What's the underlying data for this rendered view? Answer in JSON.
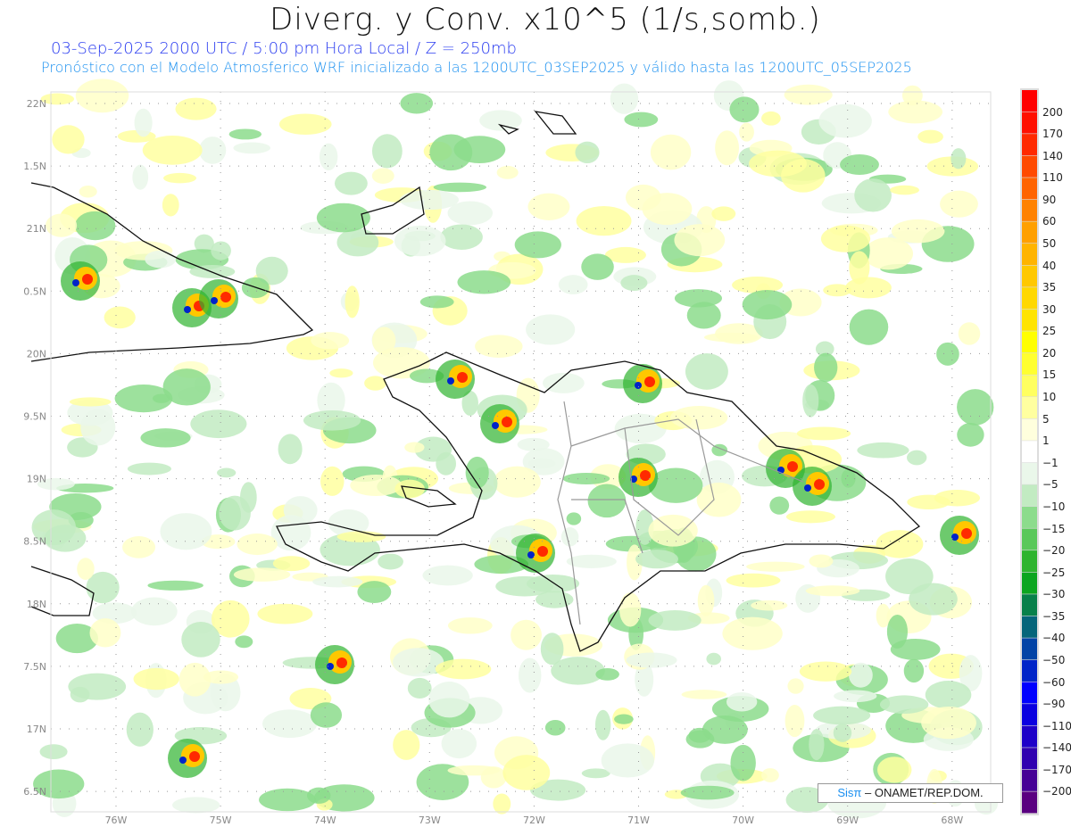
{
  "header": {
    "title": "Diverg. y Conv. x10^5 (1/s,somb.)",
    "subtitle": "03-Sep-2025  2000 UTC / 5:00 pm Hora Local / Z = 250mb",
    "description": "Pronóstico con el Modelo Atmosferico WRF inicializado a las 1200UTC_03SEP2025 y válido hasta las  1200UTC_05SEP2025"
  },
  "axes": {
    "lat_labels": [
      "22N",
      "1.5N",
      "21N",
      "0.5N",
      "20N",
      "9.5N",
      "19N",
      "8.5N",
      "18N",
      "7.5N",
      "17N",
      "6.5N"
    ],
    "lon_labels": [
      "76W",
      "75W",
      "74W",
      "73W",
      "72W",
      "71W",
      "70W",
      "69W",
      "68W"
    ]
  },
  "colorbar": {
    "labels": [
      "200",
      "170",
      "140",
      "110",
      "90",
      "60",
      "50",
      "40",
      "35",
      "30",
      "25",
      "20",
      "15",
      "10",
      "5",
      "1",
      "−1",
      "−5",
      "−10",
      "−15",
      "−20",
      "−25",
      "−30",
      "−35",
      "−40",
      "−50",
      "−60",
      "−90",
      "−110",
      "−140",
      "−170",
      "−200"
    ],
    "colors": [
      "#ff0000",
      "#ff1000",
      "#ff2a00",
      "#ff4a00",
      "#ff6400",
      "#ff8200",
      "#ffa000",
      "#ffb400",
      "#ffc800",
      "#ffd800",
      "#ffe400",
      "#ffff00",
      "#ffff30",
      "#ffff60",
      "#ffffa0",
      "#ffffdd",
      "#ffffff",
      "#eaf7ea",
      "#c2ebc2",
      "#8cdc8c",
      "#5ac85a",
      "#2fb42f",
      "#0ca520",
      "#08804a",
      "#05657a",
      "#0344a6",
      "#0024c8",
      "#0000ff",
      "#0a00e0",
      "#1e00c8",
      "#3000b0",
      "#460095",
      "#5a0080"
    ]
  },
  "credit": {
    "logo": "Sisπ",
    "text": "– ONAMET/REP.DOM."
  }
}
